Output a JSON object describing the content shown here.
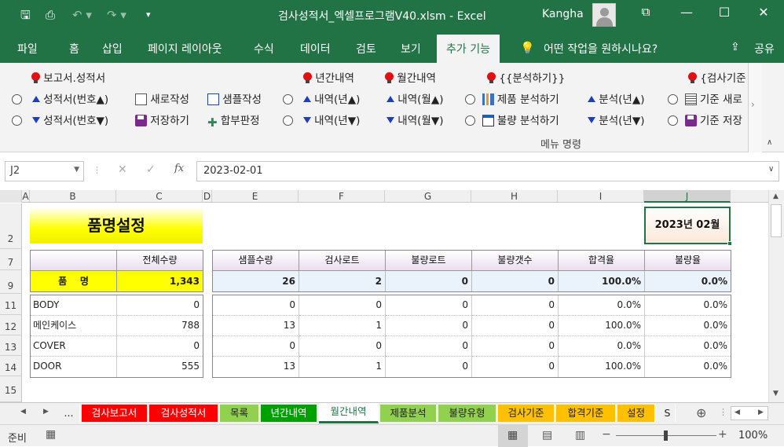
{
  "window": {
    "title": "검사성적서_엑셀프로그램V40.xlsm  -  Excel",
    "user": "Kangha"
  },
  "menu_tabs": [
    "파일",
    "홈",
    "삽입",
    "페이지 레이아웃",
    "수식",
    "데이터",
    "검토",
    "보기",
    "추가 기능",
    "어떤 작업을 원하시나요?",
    "공유"
  ],
  "ribbon": {
    "group_report": "보고서.성적서",
    "report_up": "성적서(번호▲)",
    "report_down": "성적서(번호▼)",
    "new_write": "새로작성",
    "sample_write": "샘플작성",
    "save": "저장하기",
    "pass_judge": "합부판정",
    "group_yearly": "년간내역",
    "yearly_up": "내역(년▲)",
    "yearly_down": "내역(년▼)",
    "group_monthly": "월간내역",
    "monthly_up": "내역(월▲)",
    "monthly_down": "내역(월▼)",
    "group_analysis": "{{분석하기}}",
    "product_analysis": "제품 분석하기",
    "defect_analysis": "불량 분석하기",
    "analysis_up": "분석(년▲)",
    "analysis_down": "분석(년▼)",
    "group_standard": "{검사기준",
    "standard_new": "기준 새로",
    "standard_save": "기준 저장",
    "footer": "메뉴 명령"
  },
  "formula_bar": {
    "name_box": "J2",
    "formula": "2023-02-01"
  },
  "columns": [
    "A",
    "B",
    "C",
    "D",
    "E",
    "F",
    "G",
    "H",
    "I",
    "J"
  ],
  "rows": [
    "2",
    "7",
    "9",
    "11",
    "12",
    "13",
    "14",
    "15"
  ],
  "sheet": {
    "title": "품명설정",
    "date_label": "2023년 02월",
    "left_header": [
      "",
      "전체수량"
    ],
    "left_summary": [
      "품    명",
      "1,343"
    ],
    "items": [
      {
        "name": "BODY",
        "total": "0",
        "sample": "0",
        "lot": "0",
        "bad_lot": "0",
        "bad_cnt": "0",
        "pass": "0.0%",
        "fail": "0.0%"
      },
      {
        "name": "메인케이스",
        "total": "788",
        "sample": "13",
        "lot": "1",
        "bad_lot": "0",
        "bad_cnt": "0",
        "pass": "100.0%",
        "fail": "0.0%"
      },
      {
        "name": "COVER",
        "total": "0",
        "sample": "0",
        "lot": "0",
        "bad_lot": "0",
        "bad_cnt": "0",
        "pass": "0.0%",
        "fail": "0.0%"
      },
      {
        "name": "DOOR",
        "total": "555",
        "sample": "13",
        "lot": "1",
        "bad_lot": "0",
        "bad_cnt": "0",
        "pass": "100.0%",
        "fail": "0.0%"
      }
    ],
    "right_headers": [
      "샘플수량",
      "검사로트",
      "불량로트",
      "불량갯수",
      "합격율",
      "불량율"
    ],
    "right_summary": [
      "26",
      "2",
      "0",
      "0",
      "100.0%",
      "0.0%"
    ]
  },
  "sheet_tabs": [
    {
      "label": "...",
      "color": "#f0f0f0"
    },
    {
      "label": "검사보고서",
      "color": "#ff0000"
    },
    {
      "label": "검사성적서",
      "color": "#ff0000"
    },
    {
      "label": "목록",
      "color": "#92d050"
    },
    {
      "label": "년간내역",
      "color": "#00a000"
    },
    {
      "label": "월간내역",
      "color": "#ffffff"
    },
    {
      "label": "제품분석",
      "color": "#92d050"
    },
    {
      "label": "불량유형",
      "color": "#92d050"
    },
    {
      "label": "검사기준",
      "color": "#ffc000"
    },
    {
      "label": "합격기준",
      "color": "#ffc000"
    },
    {
      "label": "설정",
      "color": "#ffc000"
    },
    {
      "label": "S",
      "color": "#f0f0f0"
    }
  ],
  "status": {
    "ready": "준비",
    "zoom": "100%"
  }
}
